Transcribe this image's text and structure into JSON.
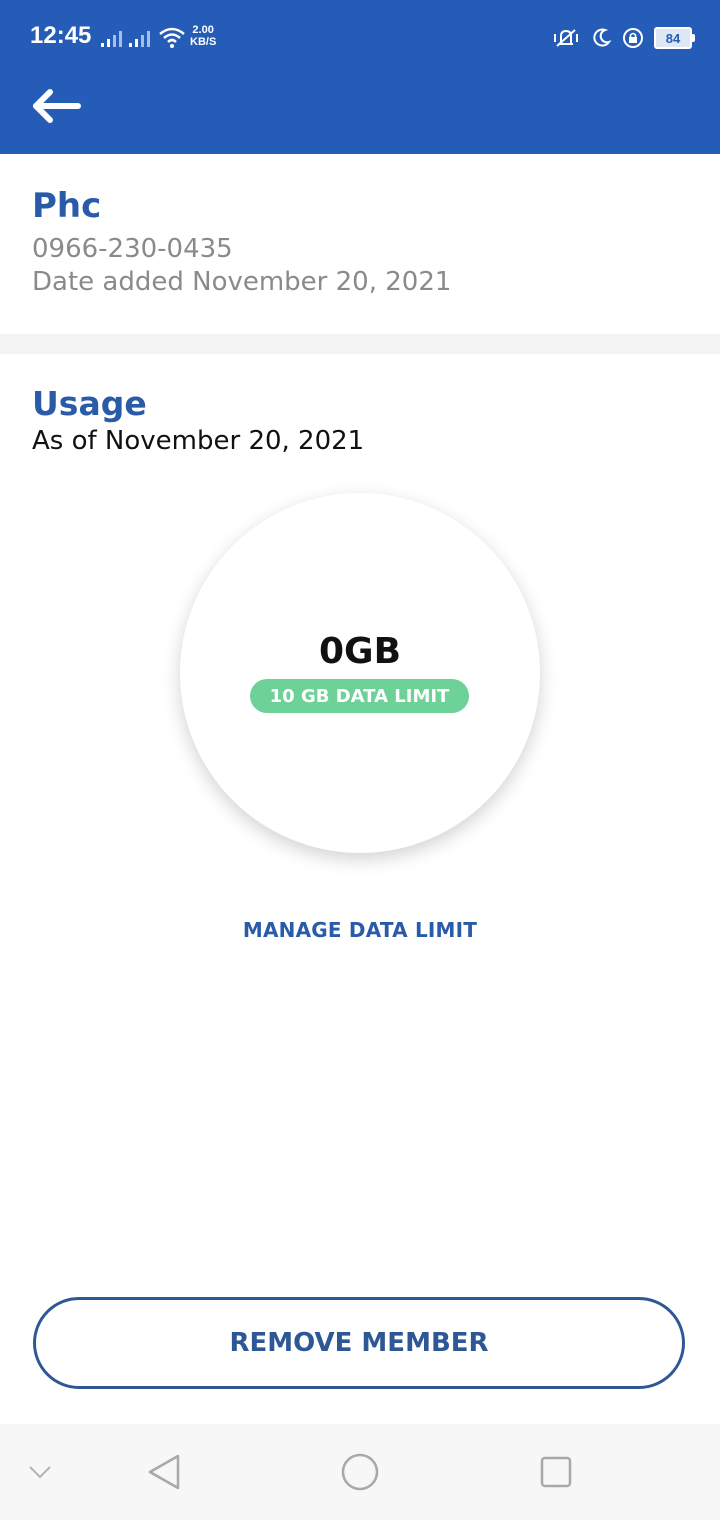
{
  "status": {
    "time": "12:45",
    "net_speed_value": "2.00",
    "net_speed_unit": "KB/S",
    "battery": "84"
  },
  "member": {
    "name": "Phc",
    "phone": "0966-230-0435",
    "date_added": "Date added November 20, 2021"
  },
  "usage": {
    "title": "Usage",
    "as_of": "As of November 20, 2021",
    "amount": "0GB",
    "limit_label": "10 GB DATA LIMIT"
  },
  "actions": {
    "manage_limit": "MANAGE DATA LIMIT",
    "remove_member": "REMOVE MEMBER"
  },
  "colors": {
    "primary": "#255CB7",
    "title_blue": "#2A5BA8",
    "pill_green": "#6ED197",
    "button_border": "#2E5795",
    "text_gray": "#8a8a8a"
  }
}
